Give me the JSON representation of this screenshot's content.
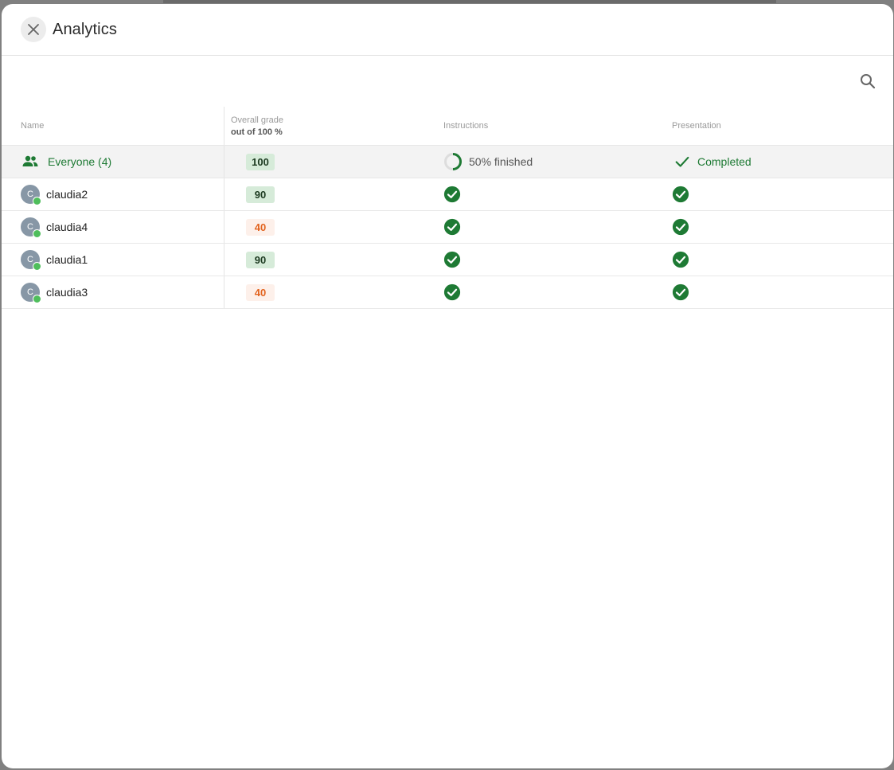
{
  "header": {
    "title": "Analytics"
  },
  "table": {
    "columns": {
      "name": "Name",
      "grade": "Overall grade",
      "grade_sub": "out of 100 %",
      "instructions": "Instructions",
      "presentation": "Presentation"
    },
    "summary": {
      "label": "Everyone (4)",
      "grade": "100",
      "instructions_status": "50% finished",
      "presentation_status": "Completed"
    },
    "rows": [
      {
        "initial": "C",
        "name": "claudia2",
        "grade": "90"
      },
      {
        "initial": "C",
        "name": "claudia4",
        "grade": "40"
      },
      {
        "initial": "C",
        "name": "claudia1",
        "grade": "90"
      },
      {
        "initial": "C",
        "name": "claudia3",
        "grade": "40"
      }
    ]
  },
  "colors": {
    "accent_green": "#1e7a34",
    "grade_good_bg": "#d6ebd9",
    "grade_low_text": "#e2631e",
    "presence": "#4fbe5c"
  },
  "icons": {
    "close": "close-icon",
    "search": "search-icon",
    "group": "group-icon",
    "check": "check-icon",
    "check_circle": "check-circle-icon",
    "progress": "progress-ring-icon"
  }
}
